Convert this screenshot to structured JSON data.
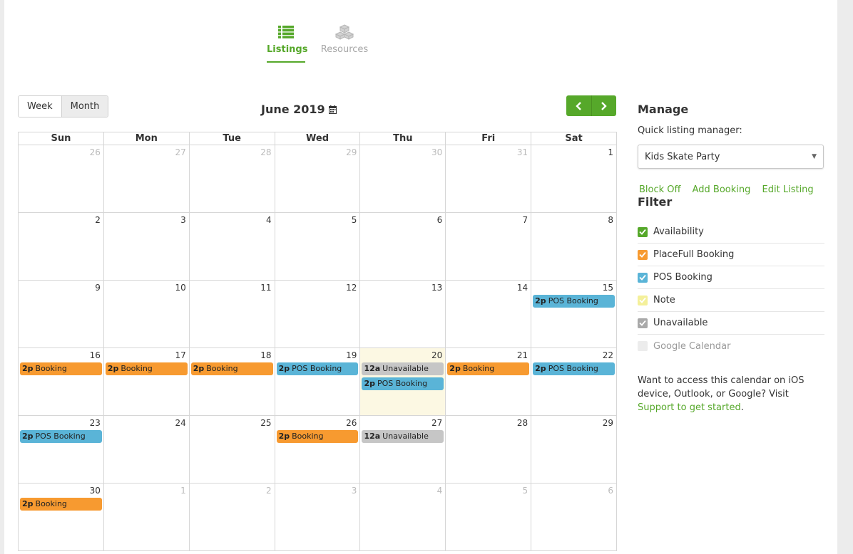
{
  "tabs": {
    "listings": "Listings",
    "resources": "Resources"
  },
  "view": {
    "week": "Week",
    "month": "Month"
  },
  "calendar": {
    "title": "June 2019",
    "weekdays": [
      "Sun",
      "Mon",
      "Tue",
      "Wed",
      "Thu",
      "Fri",
      "Sat"
    ],
    "weeks": [
      [
        {
          "d": "26",
          "other": true
        },
        {
          "d": "27",
          "other": true
        },
        {
          "d": "28",
          "other": true
        },
        {
          "d": "29",
          "other": true
        },
        {
          "d": "30",
          "other": true
        },
        {
          "d": "31",
          "other": true
        },
        {
          "d": "1"
        }
      ],
      [
        {
          "d": "2"
        },
        {
          "d": "3"
        },
        {
          "d": "4"
        },
        {
          "d": "5"
        },
        {
          "d": "6"
        },
        {
          "d": "7"
        },
        {
          "d": "8"
        }
      ],
      [
        {
          "d": "9"
        },
        {
          "d": "10"
        },
        {
          "d": "11"
        },
        {
          "d": "12"
        },
        {
          "d": "13"
        },
        {
          "d": "14"
        },
        {
          "d": "15",
          "events": [
            {
              "time": "2p",
              "label": "POS Booking",
              "type": "pos"
            }
          ]
        }
      ],
      [
        {
          "d": "16",
          "events": [
            {
              "time": "2p",
              "label": "Booking",
              "type": "booking"
            }
          ]
        },
        {
          "d": "17",
          "events": [
            {
              "time": "2p",
              "label": "Booking",
              "type": "booking"
            }
          ]
        },
        {
          "d": "18",
          "events": [
            {
              "time": "2p",
              "label": "Booking",
              "type": "booking"
            }
          ]
        },
        {
          "d": "19",
          "events": [
            {
              "time": "2p",
              "label": "POS Booking",
              "type": "pos"
            }
          ]
        },
        {
          "d": "20",
          "today": true,
          "events": [
            {
              "time": "12a",
              "label": "Unavailable",
              "type": "unavailable"
            },
            {
              "time": "2p",
              "label": "POS Booking",
              "type": "pos"
            }
          ]
        },
        {
          "d": "21",
          "events": [
            {
              "time": "2p",
              "label": "Booking",
              "type": "booking"
            }
          ]
        },
        {
          "d": "22",
          "events": [
            {
              "time": "2p",
              "label": "POS Booking",
              "type": "pos"
            }
          ]
        }
      ],
      [
        {
          "d": "23",
          "events": [
            {
              "time": "2p",
              "label": "POS Booking",
              "type": "pos"
            }
          ]
        },
        {
          "d": "24"
        },
        {
          "d": "25"
        },
        {
          "d": "26",
          "events": [
            {
              "time": "2p",
              "label": "Booking",
              "type": "booking"
            }
          ]
        },
        {
          "d": "27",
          "events": [
            {
              "time": "12a",
              "label": "Unavailable",
              "type": "unavailable"
            }
          ]
        },
        {
          "d": "28"
        },
        {
          "d": "29"
        }
      ],
      [
        {
          "d": "30",
          "events": [
            {
              "time": "2p",
              "label": "Booking",
              "type": "booking"
            }
          ]
        },
        {
          "d": "1",
          "other": true
        },
        {
          "d": "2",
          "other": true
        },
        {
          "d": "3",
          "other": true
        },
        {
          "d": "4",
          "other": true
        },
        {
          "d": "5",
          "other": true
        },
        {
          "d": "6",
          "other": true
        }
      ]
    ]
  },
  "sidebar": {
    "manage_title": "Manage",
    "quick_label": "Quick listing manager:",
    "listing_value": "Kids Skate Party",
    "links": {
      "block_off": "Block Off",
      "add_booking": "Add Booking",
      "edit_listing": "Edit Listing"
    },
    "filter_title": "Filter",
    "filters": [
      {
        "label": "Availability",
        "color": "#56a82a",
        "checked": true
      },
      {
        "label": "PlaceFull Booking",
        "color": "#f79a30",
        "checked": true
      },
      {
        "label": "POS Booking",
        "color": "#5ab4d7",
        "checked": true
      },
      {
        "label": "Note",
        "color": "#f4f09a",
        "checked": true
      },
      {
        "label": "Unavailable",
        "color": "#a9a9a9",
        "checked": true
      },
      {
        "label": "Google Calendar",
        "color": "#ececec",
        "checked": false,
        "muted": true
      }
    ],
    "promo_text": "Want to access this calendar on iOS device, Outlook, or Google? Visit ",
    "promo_link": "Support to get started",
    "promo_end": "."
  },
  "colors": {
    "accent": "#56a82a",
    "booking": "#f79a30",
    "pos": "#5ab4d7",
    "unavailable": "#c6c6c6",
    "today": "#fcf8e3"
  }
}
